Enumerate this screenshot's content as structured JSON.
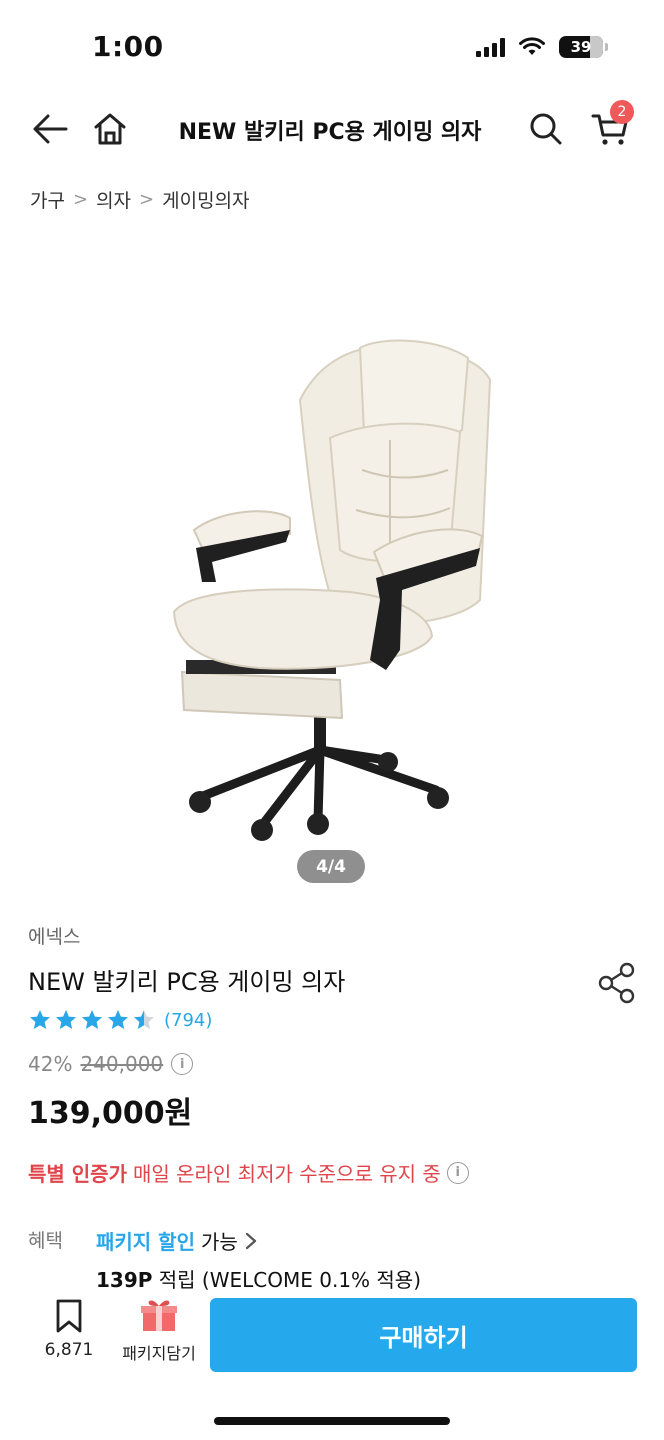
{
  "status_bar": {
    "time": "1:00",
    "battery": "39"
  },
  "header": {
    "title": "NEW 발키리 PC용 게이밍 의자",
    "cart_count": "2"
  },
  "breadcrumb": {
    "items": [
      "가구",
      "의자",
      "게이밍의자"
    ],
    "separator": ">"
  },
  "gallery": {
    "counter": "4/4"
  },
  "product": {
    "brand": "에넥스",
    "name": "NEW 발키리 PC용 게이밍 의자",
    "rating_stars": 4.5,
    "review_count": "(794)",
    "discount_rate": "42%",
    "original_price": "240,000",
    "sale_price": "139,000원"
  },
  "certification": {
    "strong": "특별 인증가",
    "text": "매일 온라인 최저가 수준으로 유지 중"
  },
  "benefit": {
    "label": "혜택",
    "package_discount": "패키지 할인",
    "available": "가능",
    "points": "139P",
    "points_text": "적립 (WELCOME 0.1% 적용)"
  },
  "bottom_bar": {
    "wishlist_count": "6,871",
    "package_label": "패키지담기",
    "buy_label": "구매하기"
  },
  "colors": {
    "accent": "#26a8ec",
    "rating": "#29a6e8",
    "badge": "#f0595a",
    "certification": "#e0454b"
  },
  "icons": [
    "back-arrow-icon",
    "home-icon",
    "search-icon",
    "cart-icon",
    "chevron-right-icon",
    "share-icon",
    "star-icon",
    "info-icon",
    "bookmark-icon",
    "package-box-icon"
  ]
}
